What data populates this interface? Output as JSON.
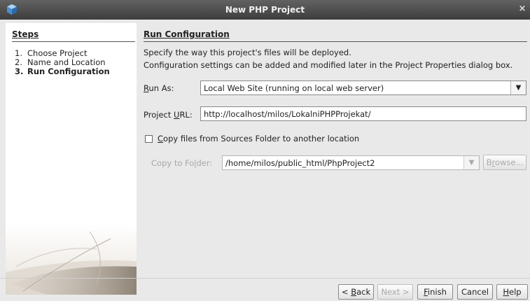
{
  "window": {
    "title": "New PHP Project",
    "close_glyph": "×"
  },
  "steps": {
    "heading": "Steps",
    "items": [
      {
        "num": "1.",
        "label": "Choose Project"
      },
      {
        "num": "2.",
        "label": "Name and Location"
      },
      {
        "num": "3.",
        "label": "Run Configuration"
      }
    ]
  },
  "run_config": {
    "heading": "Run Configuration",
    "desc1": "Specify the way this project's files will be deployed.",
    "desc2": "Configuration settings can be added and modified later in the Project Properties dialog box.",
    "run_as": {
      "label_mn": "R",
      "label_rest": "un As:",
      "value": "Local Web Site (running on local web server)"
    },
    "project_url": {
      "label_pre": "Project ",
      "label_mn": "U",
      "label_rest": "RL:",
      "value": "http://localhost/milos/LokalniPHPProjekat/"
    },
    "copy_files": {
      "label_mn": "C",
      "label_rest": "opy files from Sources Folder to another location",
      "checked": false
    },
    "copy_to_folder": {
      "label_pre": "Copy to Fo",
      "label_mn": "l",
      "label_rest": "der:",
      "value": "/home/milos/public_html/PhpProject2"
    },
    "browse": {
      "pre": "B",
      "mn": "r",
      "rest": "owse..."
    }
  },
  "buttons": {
    "back": {
      "pre": "< ",
      "mn": "B",
      "rest": "ack"
    },
    "next": "Next >",
    "finish": {
      "mn": "F",
      "rest": "inish"
    },
    "cancel": "Cancel",
    "help": {
      "mn": "H",
      "rest": "elp"
    }
  }
}
